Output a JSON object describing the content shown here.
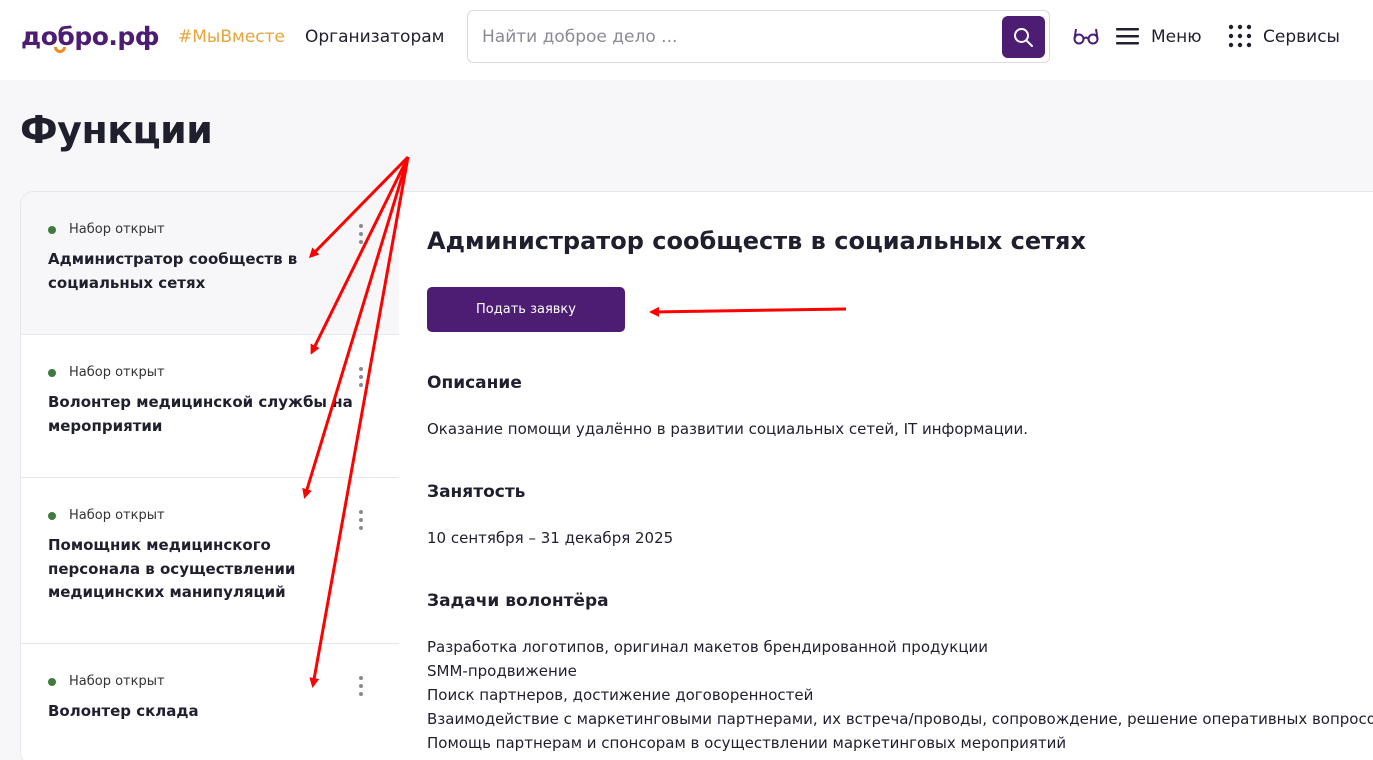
{
  "header": {
    "logo": "добро.рф",
    "hashtag": "#МыВместе",
    "organizers_link": "Организаторам",
    "search_placeholder": "Найти доброе дело ...",
    "menu_label": "Меню",
    "services_label": "Сервисы"
  },
  "page": {
    "title": "Функции"
  },
  "roles": [
    {
      "status": "Набор открыт",
      "title": "Администратор сообществ в социальных сетях"
    },
    {
      "status": "Набор открыт",
      "title": "Волонтер медицинской службы на мероприятии"
    },
    {
      "status": "Набор открыт",
      "title": "Помощник медицинского персонала в осуществлении медицинских манипуляций"
    },
    {
      "status": "Набор открыт",
      "title": "Волонтер склада"
    }
  ],
  "detail": {
    "title": "Администратор сообществ в социальных сетях",
    "apply_button": "Подать заявку",
    "description_heading": "Описание",
    "description_text": "Оказание помощи удалённо в развитии социальных сетей, IT информации.",
    "employment_heading": "Занятость",
    "employment_text": "10 сентября – 31 декабря 2025",
    "tasks_heading": "Задачи волонтёра",
    "tasks": [
      "Разработка логотипов, оригинал макетов брендированной продукции",
      "SMM-продвижение",
      "Поиск партнеров, достижение договоренностей",
      "Взаимодействие с маркетинговыми партнерами, их встреча/проводы, сопровождение, решение оперативных вопросов",
      "Помощь партнерам и спонсорам в осуществлении маркетинговых мероприятий"
    ]
  },
  "colors": {
    "brand": "#4d1c73",
    "hashtag": "#e8a33b",
    "status_open": "#3f7a3f",
    "annotation_arrow": "#ff0000"
  }
}
